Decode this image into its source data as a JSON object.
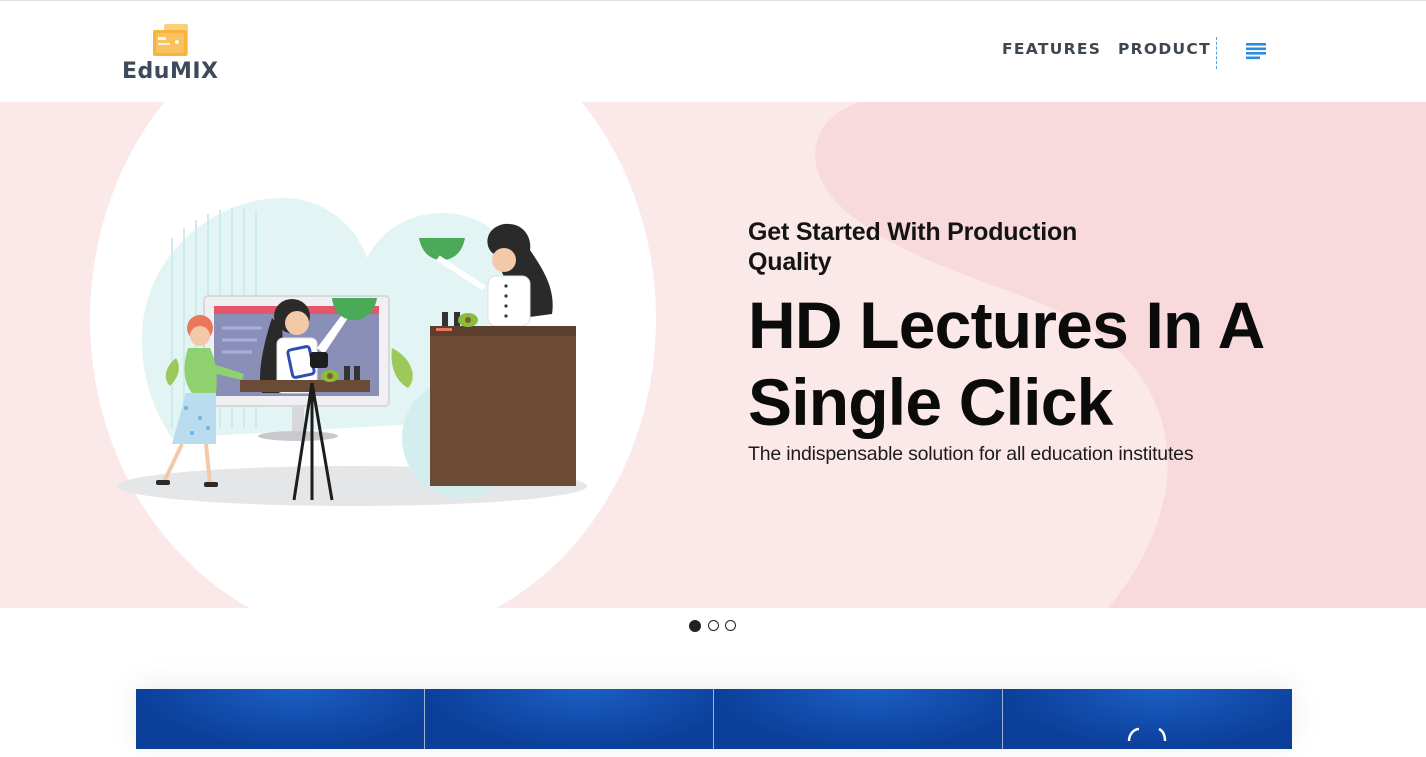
{
  "header": {
    "logo_text": "EduMIX",
    "nav": [
      {
        "label": "FEATURES"
      },
      {
        "label": "PRODUCT"
      }
    ],
    "menu_icon": "hamburger-menu-icon"
  },
  "hero": {
    "kicker": "Get Started With Production Quality",
    "title": "HD Lectures In A Single Click",
    "subtitle": "The indispensable solution for all education institutes",
    "illustration": "chef-recording-cooking-lecture-illustration"
  },
  "carousel": {
    "slide_count": 3,
    "active_index": 0
  },
  "colors": {
    "hero_background": "#fbe8e8",
    "hero_blob": "#f8dadd",
    "logo_orange": "#f6b43c",
    "logo_text": "#3c4a5c",
    "menu_icon": "#2f8be0",
    "strip_blue": "#0c3f9a"
  },
  "feature_strip": {
    "panel_count": 4
  }
}
